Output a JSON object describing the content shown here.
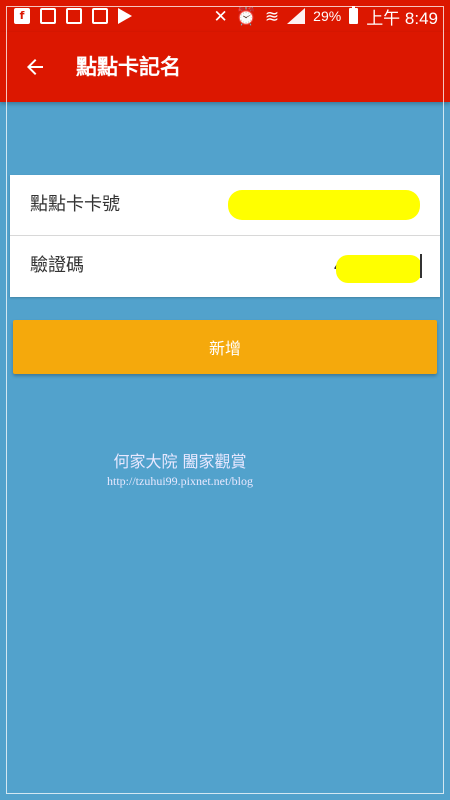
{
  "status_bar": {
    "battery_percent": "29%",
    "time": "上午 8:49"
  },
  "toolbar": {
    "title": "點點卡記名",
    "back_icon": "arrow-left-icon"
  },
  "form": {
    "card_label": "點點卡卡號",
    "code_label": "驗證碼",
    "code_value_visible": "4"
  },
  "actions": {
    "add_label": "新增"
  },
  "watermark": {
    "name": "何家大院 闔家觀賞",
    "url": "http://tzuhui99.pixnet.net/blog"
  },
  "colors": {
    "header": "#dc1700",
    "background": "#52a2cc",
    "button": "#f5a90c",
    "redaction": "#ffff00"
  }
}
